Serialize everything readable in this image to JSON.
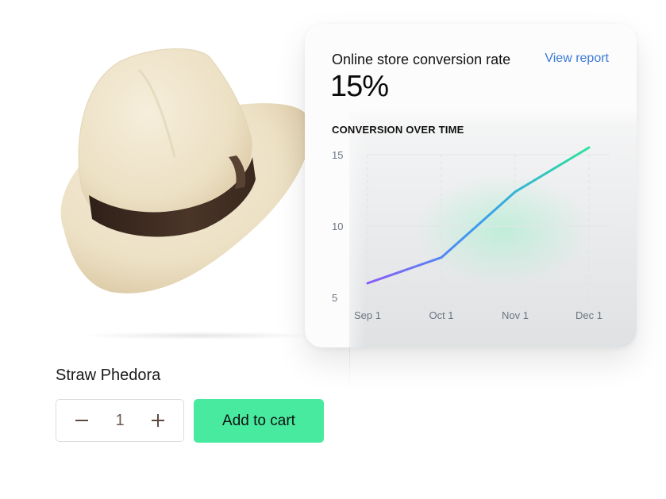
{
  "product": {
    "name": "Straw Phedora",
    "image_alt": "straw-fedora-hat",
    "quantity": "1",
    "decrement_icon": "minus-icon",
    "increment_icon": "plus-icon",
    "add_to_cart_label": "Add to cart",
    "colors": {
      "add_button": "#48eaa0",
      "band": "#3e2a20",
      "straw": "#efe4cc"
    }
  },
  "card": {
    "title": "Online store conversion rate",
    "link_label": "View report",
    "value": "15%",
    "subheading": "CONVERSION OVER TIME",
    "colors": {
      "link": "#3c7ad6",
      "line_start": "#8b5cf6",
      "line_mid": "#3b9cf0",
      "line_end": "#2ee39a"
    }
  },
  "chart_data": {
    "type": "line",
    "title": "CONVERSION OVER TIME",
    "xlabel": "",
    "ylabel": "",
    "categories": [
      "Sep 1",
      "Oct 1",
      "Nov 1",
      "Dec 1"
    ],
    "series": [
      {
        "name": "Conversion rate",
        "values": [
          6.0,
          7.8,
          12.4,
          15.5
        ]
      }
    ],
    "yticks": [
      5,
      10,
      15
    ],
    "ylim": [
      5,
      15.5
    ],
    "grid": true,
    "legend": "none"
  }
}
